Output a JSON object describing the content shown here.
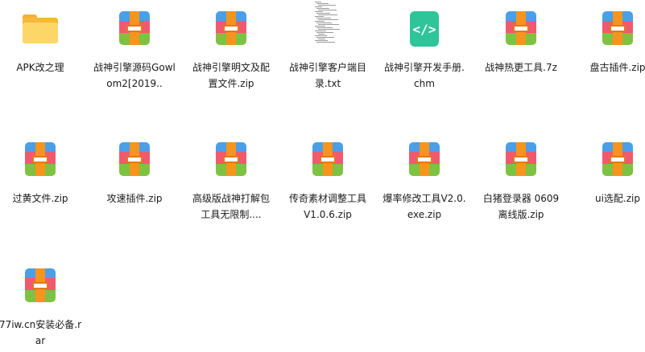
{
  "files": [
    {
      "name": "APK改之理",
      "icon": "folder-icon"
    },
    {
      "name": "战神引擎源码Gowlom2[2019..",
      "icon": "archive-icon"
    },
    {
      "name": "战神引擎明文及配置文件.zip",
      "icon": "archive-icon"
    },
    {
      "name": "战神引擎客户端目录.txt",
      "icon": "text-file-icon"
    },
    {
      "name": "战神引擎开发手册.chm",
      "icon": "chm-icon"
    },
    {
      "name": "战神热更工具.7z",
      "icon": "archive-icon"
    },
    {
      "name": "盘古插件.zip",
      "icon": "archive-icon"
    },
    {
      "name": "过黄文件.zip",
      "icon": "archive-icon"
    },
    {
      "name": "攻速插件.zip",
      "icon": "archive-icon"
    },
    {
      "name": "高级版战神打解包工具无限制....",
      "icon": "archive-icon"
    },
    {
      "name": "传奇素材调整工具V1.0.6.zip",
      "icon": "archive-icon"
    },
    {
      "name": "爆率修改工具V2.0.exe.zip",
      "icon": "archive-icon"
    },
    {
      "name": "白猪登录器 0609离线版.zip",
      "icon": "archive-icon"
    },
    {
      "name": "ui选配.zip",
      "icon": "archive-icon"
    },
    {
      "name": "77iw.cn安装必备.rar",
      "icon": "archive-icon"
    }
  ],
  "colors": {
    "folder": "#f6b93b",
    "archive_blue": "#4a9fe8",
    "archive_red": "#f05a6e",
    "archive_green": "#7dc242",
    "archive_strap": "#f7941d",
    "chm": "#2fc49a"
  }
}
